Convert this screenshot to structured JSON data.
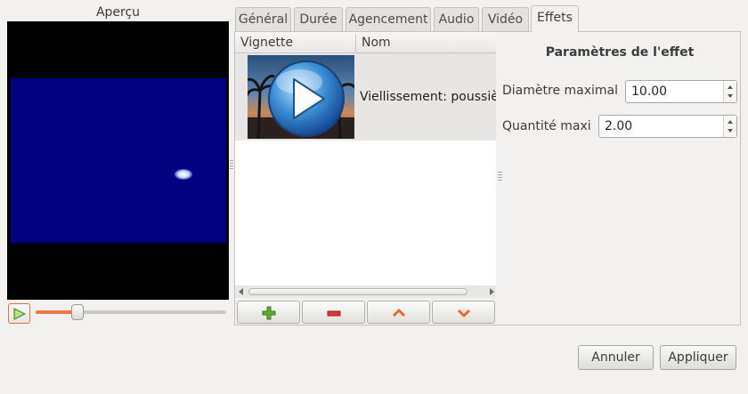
{
  "preview": {
    "title": "Aperçu",
    "video_background": "#000080",
    "slider_fraction": 0.22
  },
  "tabs": [
    {
      "label": "Général"
    },
    {
      "label": "Durée"
    },
    {
      "label": "Agencement"
    },
    {
      "label": "Audio"
    },
    {
      "label": "Vidéo"
    },
    {
      "label": "Effets",
      "active": true
    }
  ],
  "effects_list": {
    "columns": [
      "Vignette",
      "Nom"
    ],
    "rows": [
      {
        "name": "Viellissement: poussière",
        "thumbnail_icon": "media-play-icon"
      }
    ],
    "tool_buttons": [
      "add-icon",
      "remove-icon",
      "move-up-icon",
      "move-down-icon"
    ]
  },
  "parameters": {
    "title": "Paramètres de l'effet",
    "fields": [
      {
        "label": "Diamètre maximal",
        "value": "10.00"
      },
      {
        "label": "Quantité maxi",
        "value": "2.00"
      }
    ]
  },
  "dialog_buttons": {
    "cancel": "Annuler",
    "apply": "Appliquer"
  },
  "colors": {
    "accent": "#f07746",
    "add": "#5cb02e",
    "remove": "#d9383a"
  }
}
